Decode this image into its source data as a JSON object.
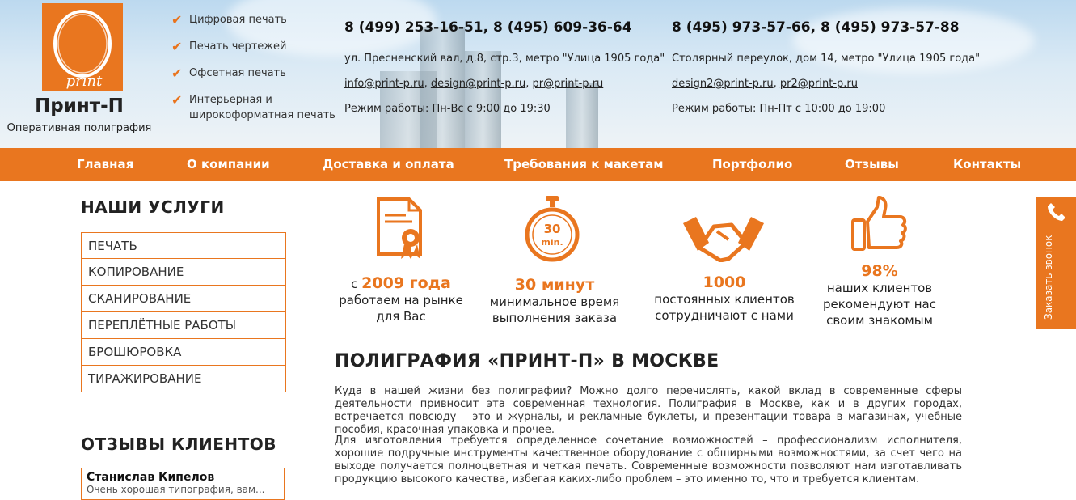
{
  "brand": {
    "name": "Принт-П",
    "tagline": "Оперативная полиграфия",
    "logo_text": "print"
  },
  "features": [
    "Цифровая печать",
    "Печать чертежей",
    "Офсетная печать",
    "Интерьерная и\nшироко­форматная печать"
  ],
  "office1": {
    "phones": "8 (499) 253-16-51, 8 (495) 609-36-64",
    "address": "ул. Пресненский вал, д.8, стр.3, метро \"Улица 1905 года\"",
    "emails": [
      "info@print-p.ru",
      "design@print-p.ru",
      "pr@print-p.ru"
    ],
    "hours": "Режим работы: Пн-Вс с 9:00 до 19:30"
  },
  "office2": {
    "phones": "8 (495) 973-57-66, 8 (495) 973-57-88",
    "address": "Столярный переулок, дом 14, метро \"Улица 1905 года\"",
    "emails": [
      "design2@print-p.ru",
      "pr2@print-p.ru"
    ],
    "hours": "Режим работы: Пн-Пт с 10:00 до 19:00"
  },
  "nav": [
    "Главная",
    "О компании",
    "Доставка и оплата",
    "Требования к макетам",
    "Портфолио",
    "Отзывы",
    "Контакты"
  ],
  "sidebar": {
    "services_title": "НАШИ УСЛУГИ",
    "services": [
      "ПЕЧАТЬ",
      "КОПИРОВАНИЕ",
      "СКАНИРОВАНИЕ",
      "ПЕРЕПЛЁТНЫЕ РАБОТЫ",
      "БРОШЮРОВКА",
      "ТИРАЖИРОВАНИЕ"
    ],
    "reviews_title": "ОТЗЫВЫ КЛИЕНТОВ",
    "review": {
      "name": "Станислав Кипелов",
      "text": "Очень хорошая типография, вам..."
    }
  },
  "stats": [
    {
      "pre": "с ",
      "big": "2009 года",
      "text": "работаем на рынке\nдля Вас",
      "icon": "certificate-icon"
    },
    {
      "pre": "",
      "big": "30 минут",
      "text": "минимальное время\nвыполнения заказа",
      "icon": "stopwatch-icon",
      "icon_text": "30",
      "icon_unit": "min."
    },
    {
      "pre": "",
      "big": "1000",
      "text": "постоянных клиентов\nсотрудничают с нами",
      "icon": "handshake-icon"
    },
    {
      "pre": "",
      "big": "98%",
      "text": "наших клиентов\nрекомендуют нас\nсвоим знакомым",
      "icon": "thumbs-up-icon"
    }
  ],
  "content": {
    "title": "ПОЛИГРАФИЯ «ПРИНТ-П» В МОСКВЕ",
    "p1": "Куда в нашей жизни без полиграфии? Можно долго перечислять, какой вклад в современные сферы деятельности привносит эта современная технология. Полиграфия в Москве, как и в других городах, встречается повсюду – это и журналы, и рекламные буклеты, и презентации товара в магазинах, учебные пособия, красочная упаковка и прочее.",
    "p2": "Для изготовления требуется определенное сочетание возможностей – профессионализм исполнителя, хорошие подручные инструменты качественное оборудование с обширными возможностями, за счет чего на выходе получается полноцветная и четкая печать. Современные возможности позволяют нам изготавливать продукцию высокого качества, избегая каких-либо проблем – это именно то, что и требуется клиентам."
  },
  "callback": {
    "label": "Заказать звонок",
    "icon": "phone-icon"
  },
  "colors": {
    "accent": "#e9761f"
  }
}
